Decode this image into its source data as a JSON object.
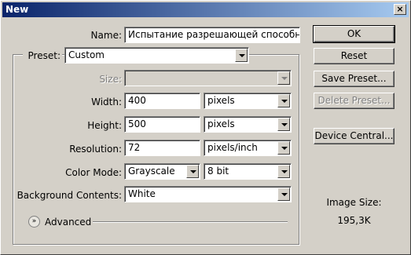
{
  "window": {
    "title": "New",
    "close_glyph": "×"
  },
  "form": {
    "name_label": "Name:",
    "name_value": "Испытание разрешающей способности",
    "preset_label": "Preset:",
    "preset_value": "Custom",
    "size_label": "Size:",
    "size_value": "",
    "width_label": "Width:",
    "width_value": "400",
    "width_unit": "pixels",
    "height_label": "Height:",
    "height_value": "500",
    "height_unit": "pixels",
    "resolution_label": "Resolution:",
    "resolution_value": "72",
    "resolution_unit": "pixels/inch",
    "color_mode_label": "Color Mode:",
    "color_mode_value": "Grayscale",
    "bit_depth_value": "8 bit",
    "background_label": "Background Contents:",
    "background_value": "White",
    "advanced_label": "Advanced",
    "advanced_glyph": "»"
  },
  "buttons": {
    "ok": "OK",
    "reset": "Reset",
    "save_preset": "Save Preset...",
    "delete_preset": "Delete Preset...",
    "device_central": "Device Central..."
  },
  "info": {
    "image_size_label": "Image Size:",
    "image_size_value": "195,3K"
  },
  "icons": [
    "close-icon",
    "dropdown-arrow-icon",
    "advanced-toggle-icon"
  ],
  "colors": {
    "titlebar_start": "#0a246a",
    "titlebar_end": "#a6caf0",
    "face": "#d4d0c8"
  }
}
